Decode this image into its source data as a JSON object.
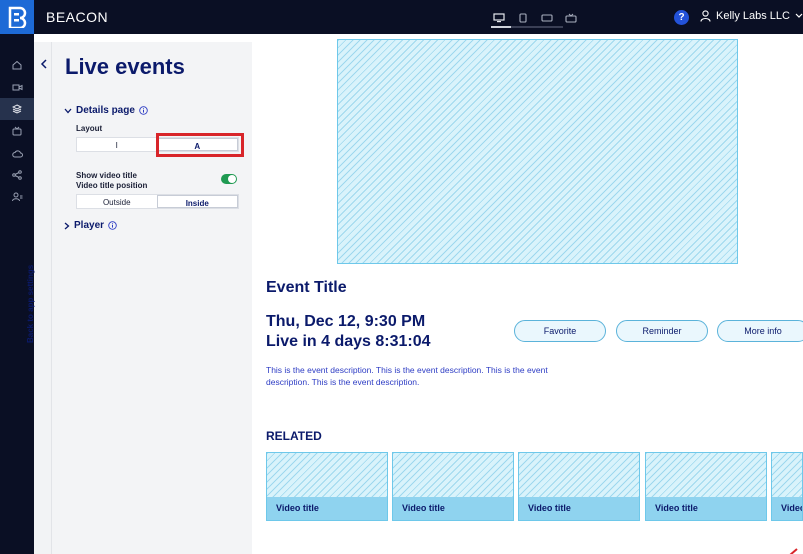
{
  "app": {
    "brand": "BEACON",
    "account": "Kelly Labs LLC",
    "help_label": "?"
  },
  "device_preview": [
    "desktop-icon",
    "tablet-icon",
    "tv-icon",
    "tv-stand-icon"
  ],
  "rail_items": [
    "home-icon",
    "video-icon",
    "layers-icon",
    "tv-icon",
    "cloud-icon",
    "share-icon",
    "user-settings-icon"
  ],
  "panel": {
    "title": "Live events",
    "back_label": "Back to app settings",
    "details_section": "Details page",
    "layout_label": "Layout",
    "layout_options": [
      "I",
      "A"
    ],
    "layout_selected": "A",
    "show_video_title_label": "Show video title",
    "video_title_position_label": "Video title position",
    "position_options": [
      "Outside",
      "Inside"
    ],
    "position_selected": "Inside",
    "player_section": "Player"
  },
  "preview": {
    "event_title": "Event Title",
    "date_line": "Thu, Dec 12, 9:30 PM",
    "countdown_line": "Live in 4 days 8:31:04",
    "buttons": [
      "Favorite",
      "Reminder",
      "More info"
    ],
    "description": "This is the event description. This is the event description. This is the event description. This is the event description.",
    "related_heading": "RELATED",
    "cards": [
      "Video title",
      "Video title",
      "Video title",
      "Video title",
      "Video title"
    ]
  },
  "colors": {
    "accent": "#0b1a6b",
    "highlight": "#d8252a",
    "toggle_on": "#1f9a52",
    "placeholder": "#d9f3fb"
  }
}
